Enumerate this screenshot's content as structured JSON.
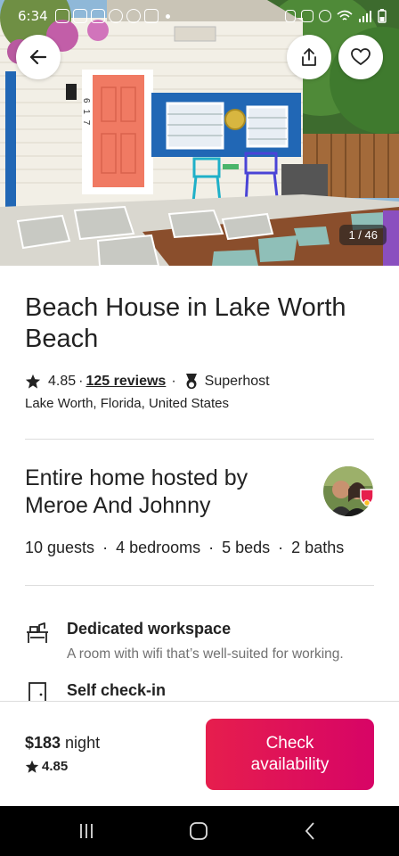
{
  "status_bar": {
    "time": "6:34",
    "icons": [
      "instagram-icon",
      "photo-icon",
      "photo-icon",
      "facebook-icon",
      "facebook-icon",
      "photo-icon",
      "nfc-icon",
      "alarm-icon",
      "wifi-icon",
      "signal-icon",
      "battery-icon"
    ]
  },
  "photo": {
    "counter": "1 / 46",
    "house_number": "6 1 7"
  },
  "listing": {
    "title": "Beach House in Lake Worth Beach",
    "rating": "4.85",
    "separator": "·",
    "reviews": "125 reviews",
    "host_status": "Superhost",
    "location": "Lake Worth, Florida, United States"
  },
  "host": {
    "heading": "Entire home hosted by Meroe And Johnny",
    "stats": [
      "10 guests",
      "4 bedrooms",
      "5 beds",
      "2 baths"
    ],
    "stat_separator": "·"
  },
  "amenities": [
    {
      "icon": "desk-icon",
      "title": "Dedicated workspace",
      "description": "A room with wifi that’s well-suited for working."
    },
    {
      "icon": "door-icon",
      "title": "Self check-in",
      "description": ""
    }
  ],
  "booking": {
    "price": "$183",
    "price_unit": " night",
    "rating": "4.85",
    "cta": "Check availability"
  },
  "colors": {
    "brand": "#e61e4d",
    "text": "#222222",
    "secondary": "#717171",
    "door": "#f07a63",
    "trim_blue": "#2167b5"
  }
}
